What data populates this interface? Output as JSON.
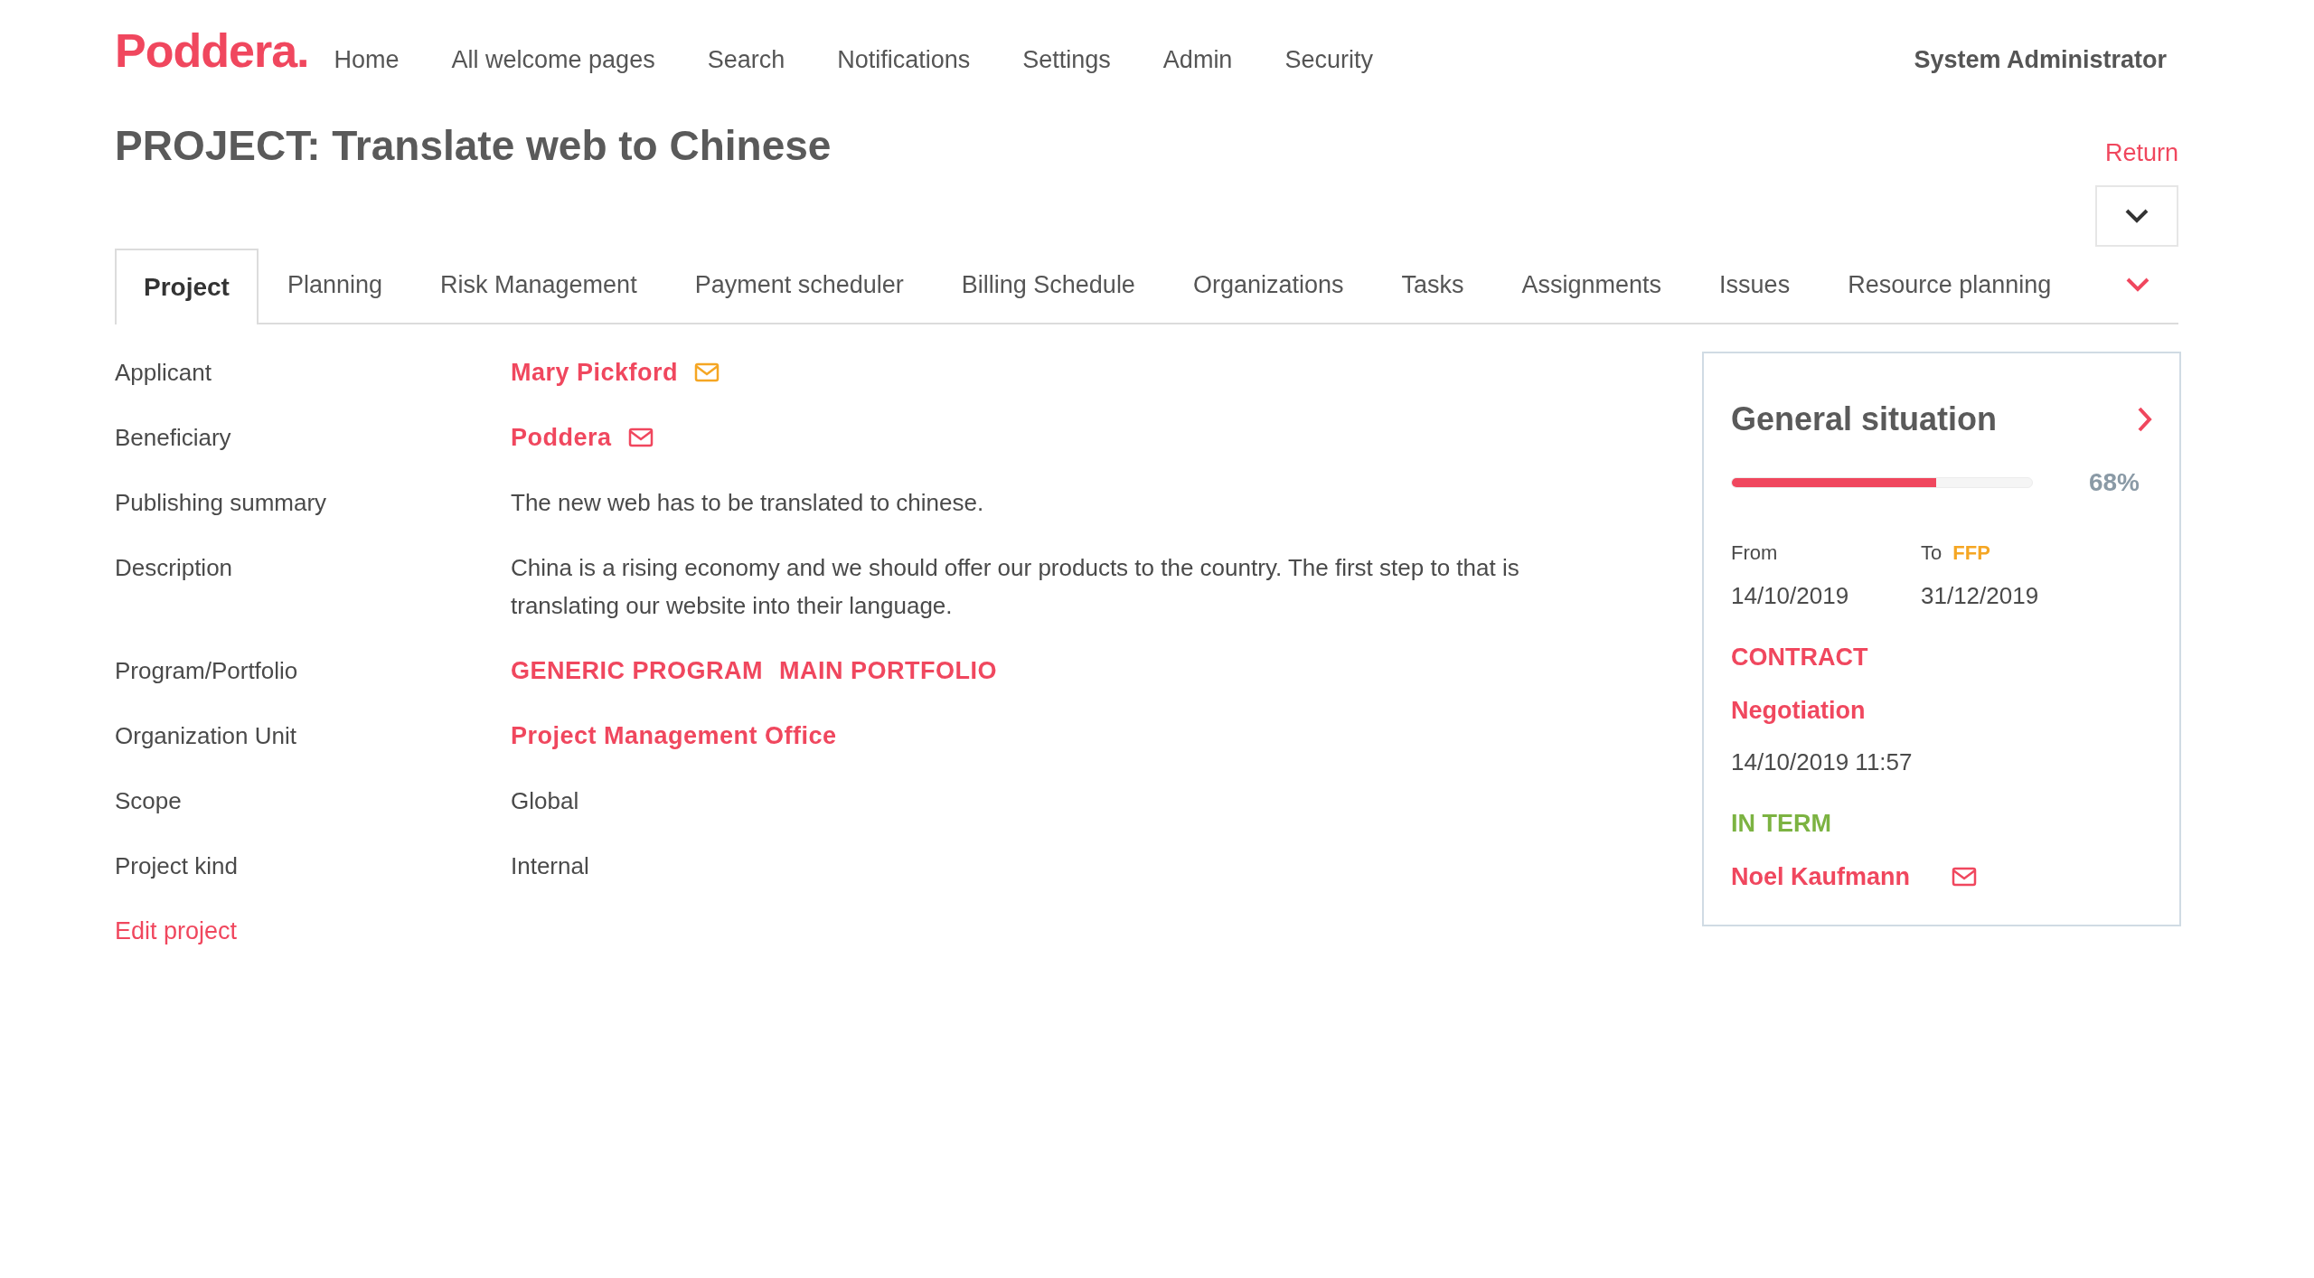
{
  "brand": "Poddera.",
  "nav": [
    {
      "label": "Home"
    },
    {
      "label": "All welcome pages"
    },
    {
      "label": "Search"
    },
    {
      "label": "Notifications"
    },
    {
      "label": "Settings"
    },
    {
      "label": "Admin"
    },
    {
      "label": "Security"
    }
  ],
  "user": "System Administrator",
  "title": "PROJECT: Translate web to Chinese",
  "return_link": "Return",
  "tabs": [
    {
      "label": "Project",
      "selected": true
    },
    {
      "label": "Planning",
      "selected": false
    },
    {
      "label": "Risk Management",
      "selected": false
    },
    {
      "label": "Payment scheduler",
      "selected": false
    },
    {
      "label": "Billing Schedule",
      "selected": false
    },
    {
      "label": "Organizations",
      "selected": false
    },
    {
      "label": "Tasks",
      "selected": false
    },
    {
      "label": "Assignments",
      "selected": false
    },
    {
      "label": "Issues",
      "selected": false
    },
    {
      "label": "Resource planning",
      "selected": false
    }
  ],
  "fields": [
    {
      "label": "Applicant",
      "kind": "link",
      "values": [
        "Mary Pickford"
      ],
      "color": "#f5a623"
    },
    {
      "label": "Beneficiary",
      "kind": "link",
      "values": [
        "Poddera"
      ],
      "color": "#f0475e"
    },
    {
      "label": "Publishing summary",
      "kind": "text",
      "values": [
        "The new web has to be translated to chinese."
      ]
    },
    {
      "label": "Description",
      "kind": "text",
      "values": [
        "China is a rising economy and we should offer our products to the country. The first step to that is translating our website into their language."
      ]
    },
    {
      "label": "Program/Portfolio",
      "kind": "link",
      "values": [
        "GENERIC PROGRAM",
        "MAIN PORTFOLIO"
      ]
    },
    {
      "label": "Organization Unit",
      "kind": "link",
      "values": [
        "Project Management Office"
      ]
    },
    {
      "label": "Scope",
      "kind": "text",
      "values": [
        "Global"
      ]
    },
    {
      "label": "Project kind",
      "kind": "text",
      "values": [
        "Internal"
      ]
    }
  ],
  "edit_link": "Edit project",
  "situation": {
    "title": "General situation",
    "level": 0.68,
    "percent": "68%",
    "from_label": "From",
    "from": "14/10/2019",
    "to_label": "To",
    "to_badge": "FFP",
    "to": "31/12/2019",
    "phase": "CONTRACT",
    "stage": "Negotiation",
    "stage_date": "14/10/2019 11:57",
    "status": "IN TERM",
    "manager": "Noel Kaufmann"
  }
}
